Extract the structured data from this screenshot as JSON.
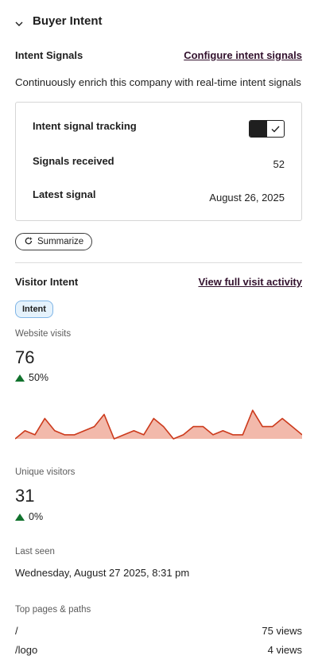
{
  "section": {
    "title": "Buyer Intent"
  },
  "intent_signals": {
    "heading": "Intent Signals",
    "configure_link": "Configure intent signals",
    "description": "Continuously enrich this company with real-time intent signals",
    "rows": {
      "tracking_label": "Intent signal tracking",
      "tracking_enabled": true,
      "received_label": "Signals received",
      "received_value": "52",
      "latest_label": "Latest signal",
      "latest_value": "August 26, 2025"
    },
    "summarize_label": "Summarize"
  },
  "visitor_intent": {
    "heading": "Visitor Intent",
    "view_link": "View full visit activity",
    "tag": "Intent",
    "website_visits": {
      "label": "Website visits",
      "value": "76",
      "change": "50%"
    },
    "unique_visitors": {
      "label": "Unique visitors",
      "value": "31",
      "change": "0%"
    },
    "last_seen": {
      "label": "Last seen",
      "value": "Wednesday, August 27 2025, 8:31 pm"
    },
    "top_pages": {
      "label": "Top pages & paths",
      "rows": [
        {
          "path": "/",
          "views": "75 views"
        },
        {
          "path": "/logo",
          "views": "4 views"
        }
      ]
    }
  },
  "colors": {
    "link": "#33122e",
    "positive": "#11722d",
    "sparkline_stroke": "#cc3a1c",
    "sparkline_fill": "#f2b9ab",
    "tag_bg": "#e5f2fc",
    "tag_border": "#7fb5e6"
  },
  "icons": {
    "collapse": "chevron-down-icon",
    "summarize": "refresh-sparkle-icon",
    "toggle_check": "checkmark-icon",
    "delta_up": "triangle-up-icon"
  },
  "chart_data": {
    "type": "area",
    "title": "",
    "xlabel": "",
    "ylabel": "",
    "x": [
      0,
      1,
      2,
      3,
      4,
      5,
      6,
      7,
      8,
      9,
      10,
      11,
      12,
      13,
      14,
      15,
      16,
      17,
      18,
      19,
      20,
      21,
      22,
      23,
      24,
      25,
      26,
      27,
      28,
      29
    ],
    "values": [
      0,
      2,
      1,
      5,
      2,
      1,
      1,
      2,
      3,
      6,
      0,
      1,
      2,
      1,
      5,
      3,
      0,
      1,
      3,
      3,
      1,
      2,
      1,
      1,
      7,
      3,
      3,
      5,
      3,
      1
    ],
    "ylim": [
      0,
      8
    ],
    "grid": false
  }
}
